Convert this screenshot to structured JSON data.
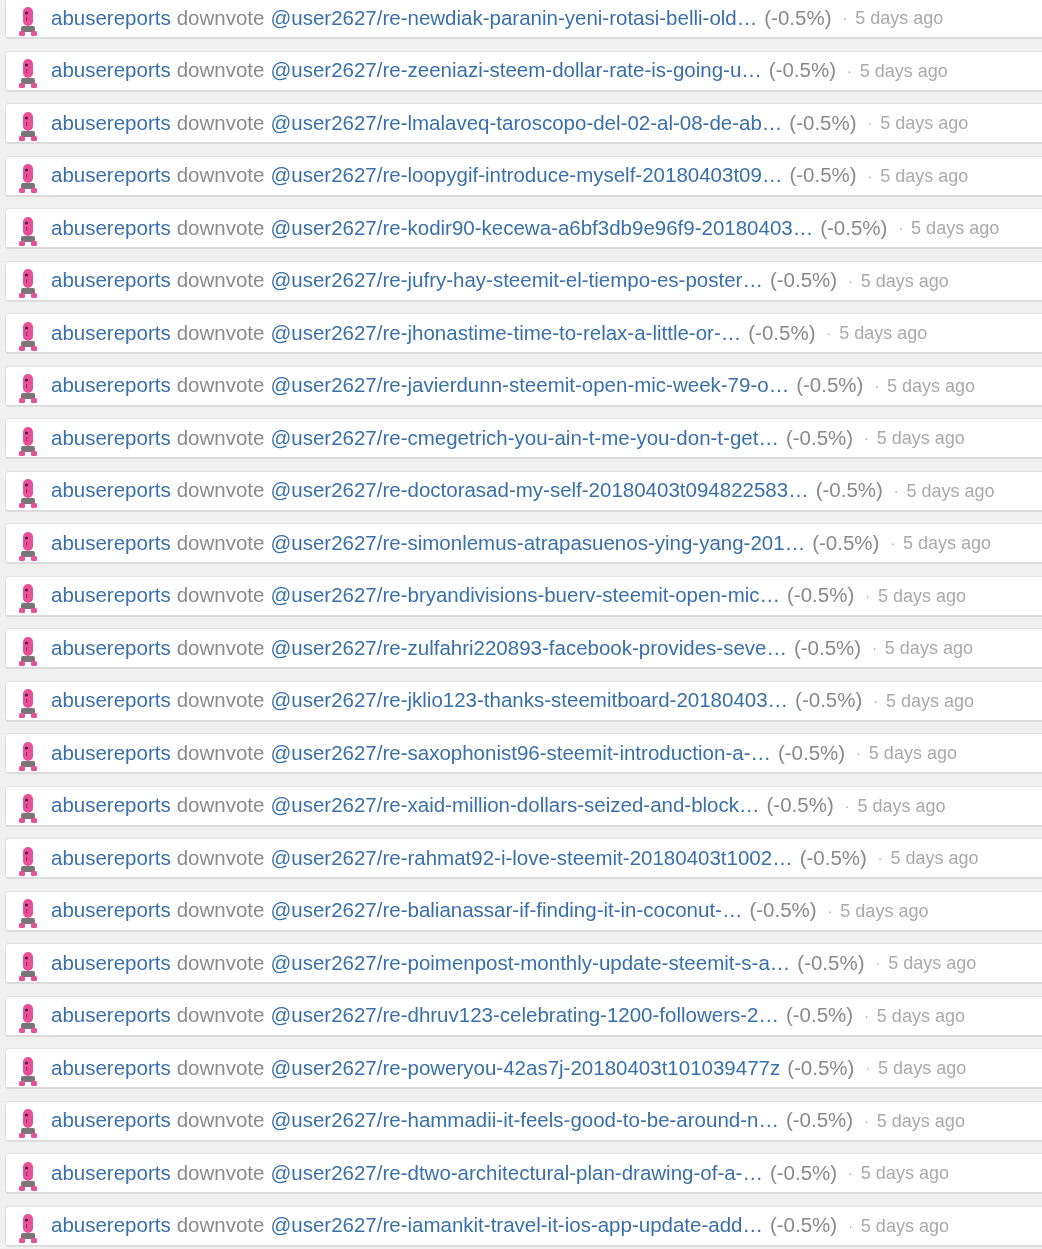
{
  "activity": [
    {
      "voter": "abusereports",
      "action": "downvote",
      "post": "@user2627/re-newdiak-paranin-yeni-rotasi-belli-old…",
      "weight": "(-0.5%)",
      "separator": "·",
      "time": "5 days ago"
    },
    {
      "voter": "abusereports",
      "action": "downvote",
      "post": "@user2627/re-zeeniazi-steem-dollar-rate-is-going-u…",
      "weight": "(-0.5%)",
      "separator": "·",
      "time": "5 days ago"
    },
    {
      "voter": "abusereports",
      "action": "downvote",
      "post": "@user2627/re-lmalaveq-taroscopo-del-02-al-08-de-ab…",
      "weight": "(-0.5%)",
      "separator": "·",
      "time": "5 days ago"
    },
    {
      "voter": "abusereports",
      "action": "downvote",
      "post": "@user2627/re-loopygif-introduce-myself-20180403t09…",
      "weight": "(-0.5%)",
      "separator": "·",
      "time": "5 days ago"
    },
    {
      "voter": "abusereports",
      "action": "downvote",
      "post": "@user2627/re-kodir90-kecewa-a6bf3db9e96f9-20180403…",
      "weight": "(-0.5%)",
      "separator": "·",
      "time": "5 days ago"
    },
    {
      "voter": "abusereports",
      "action": "downvote",
      "post": "@user2627/re-jufry-hay-steemit-el-tiempo-es-poster…",
      "weight": "(-0.5%)",
      "separator": "·",
      "time": "5 days ago"
    },
    {
      "voter": "abusereports",
      "action": "downvote",
      "post": "@user2627/re-jhonastime-time-to-relax-a-little-or-…",
      "weight": "(-0.5%)",
      "separator": "·",
      "time": "5 days ago"
    },
    {
      "voter": "abusereports",
      "action": "downvote",
      "post": "@user2627/re-javierdunn-steemit-open-mic-week-79-o…",
      "weight": "(-0.5%)",
      "separator": "·",
      "time": "5 days ago"
    },
    {
      "voter": "abusereports",
      "action": "downvote",
      "post": "@user2627/re-cmegetrich-you-ain-t-me-you-don-t-get…",
      "weight": "(-0.5%)",
      "separator": "·",
      "time": "5 days ago"
    },
    {
      "voter": "abusereports",
      "action": "downvote",
      "post": "@user2627/re-doctorasad-my-self-20180403t094822583…",
      "weight": "(-0.5%)",
      "separator": "·",
      "time": "5 days ago"
    },
    {
      "voter": "abusereports",
      "action": "downvote",
      "post": "@user2627/re-simonlemus-atrapasuenos-ying-yang-201…",
      "weight": "(-0.5%)",
      "separator": "·",
      "time": "5 days ago"
    },
    {
      "voter": "abusereports",
      "action": "downvote",
      "post": "@user2627/re-bryandivisions-buerv-steemit-open-mic…",
      "weight": "(-0.5%)",
      "separator": "·",
      "time": "5 days ago"
    },
    {
      "voter": "abusereports",
      "action": "downvote",
      "post": "@user2627/re-zulfahri220893-facebook-provides-seve…",
      "weight": "(-0.5%)",
      "separator": "·",
      "time": "5 days ago"
    },
    {
      "voter": "abusereports",
      "action": "downvote",
      "post": "@user2627/re-jklio123-thanks-steemitboard-20180403…",
      "weight": "(-0.5%)",
      "separator": "·",
      "time": "5 days ago"
    },
    {
      "voter": "abusereports",
      "action": "downvote",
      "post": "@user2627/re-saxophonist96-steemit-introduction-a-…",
      "weight": "(-0.5%)",
      "separator": "·",
      "time": "5 days ago"
    },
    {
      "voter": "abusereports",
      "action": "downvote",
      "post": "@user2627/re-xaid-million-dollars-seized-and-block…",
      "weight": "(-0.5%)",
      "separator": "·",
      "time": "5 days ago"
    },
    {
      "voter": "abusereports",
      "action": "downvote",
      "post": "@user2627/re-rahmat92-i-love-steemit-20180403t1002…",
      "weight": "(-0.5%)",
      "separator": "·",
      "time": "5 days ago"
    },
    {
      "voter": "abusereports",
      "action": "downvote",
      "post": "@user2627/re-balianassar-if-finding-it-in-coconut-…",
      "weight": "(-0.5%)",
      "separator": "·",
      "time": "5 days ago"
    },
    {
      "voter": "abusereports",
      "action": "downvote",
      "post": "@user2627/re-poimenpost-monthly-update-steemit-s-a…",
      "weight": "(-0.5%)",
      "separator": "·",
      "time": "5 days ago"
    },
    {
      "voter": "abusereports",
      "action": "downvote",
      "post": "@user2627/re-dhruv123-celebrating-1200-followers-2…",
      "weight": "(-0.5%)",
      "separator": "·",
      "time": "5 days ago"
    },
    {
      "voter": "abusereports",
      "action": "downvote",
      "post": "@user2627/re-poweryou-42as7j-20180403t101039477z",
      "weight": "(-0.5%)",
      "separator": "·",
      "time": "5 days ago"
    },
    {
      "voter": "abusereports",
      "action": "downvote",
      "post": "@user2627/re-hammadii-it-feels-good-to-be-around-n…",
      "weight": "(-0.5%)",
      "separator": "·",
      "time": "5 days ago"
    },
    {
      "voter": "abusereports",
      "action": "downvote",
      "post": "@user2627/re-dtwo-architectural-plan-drawing-of-a-…",
      "weight": "(-0.5%)",
      "separator": "·",
      "time": "5 days ago"
    },
    {
      "voter": "abusereports",
      "action": "downvote",
      "post": "@user2627/re-iamankit-travel-it-ios-app-update-add…",
      "weight": "(-0.5%)",
      "separator": "·",
      "time": "5 days ago"
    }
  ]
}
